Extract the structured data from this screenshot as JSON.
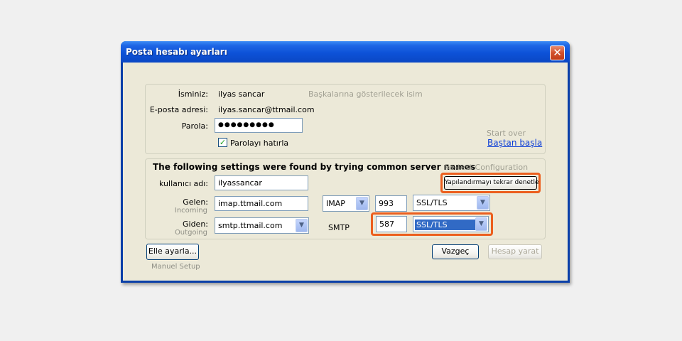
{
  "window": {
    "title": "Posta hesabı ayarları"
  },
  "account": {
    "name_label": "İsminiz:",
    "name_value": "ilyas sancar",
    "name_hint": "Başkalarına gösterilecek isim",
    "email_label": "E-posta adresi:",
    "email_value": "ilyas.sancar@ttmail.com",
    "password_label": "Parola:",
    "password_value": "●●●●●●●●●",
    "remember_label": "Parolayı hatırla",
    "remember_checked": true,
    "start_over_label": "Start over",
    "start_over_link": "Baştan başla"
  },
  "server": {
    "heading": "The following settings were found by trying common server names",
    "retest_label": "Re-test Configuration",
    "retest_button": "Yapılandırmayı tekrar denetle",
    "username_label": "kullanıcı adı:",
    "username_value": "ilyassancar",
    "incoming_label": "Gelen:",
    "incoming_sub": "Incoming",
    "incoming_host": "imap.ttmail.com",
    "incoming_protocol": "IMAP",
    "incoming_port": "993",
    "incoming_ssl": "SSL/TLS",
    "outgoing_label": "Giden:",
    "outgoing_sub": "Outgoing",
    "outgoing_host": "smtp.ttmail.com",
    "outgoing_protocol": "SMTP",
    "outgoing_port": "587",
    "outgoing_ssl": "SSL/TLS"
  },
  "footer": {
    "manual_button": "Elle ayarla...",
    "manual_sub": "Manuel Setup",
    "cancel_button": "Vazgeç",
    "create_button": "Hesap yarat"
  },
  "colors": {
    "highlight": "#ec5f1e",
    "titlebar": "#0d52d8",
    "dialog_bg": "#ece9d8",
    "selection": "#316ac5"
  }
}
